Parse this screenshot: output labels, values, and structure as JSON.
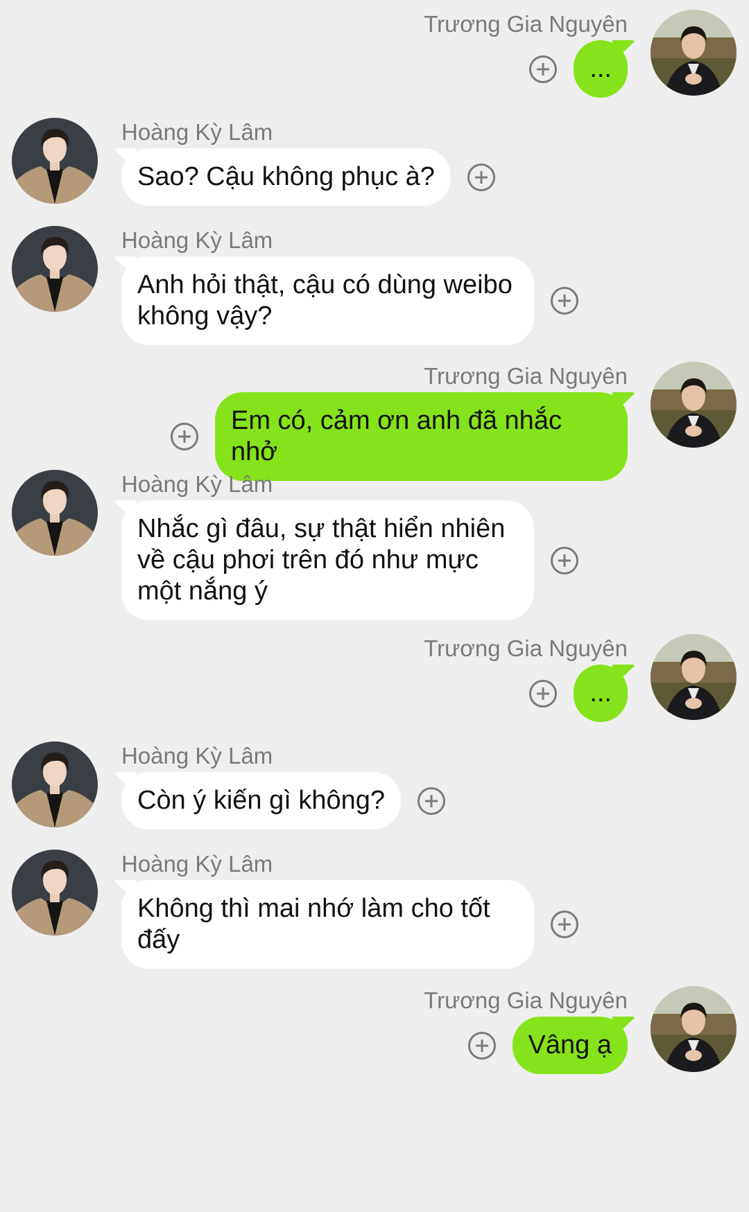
{
  "colors": {
    "background": "#eeeeee",
    "incoming_bubble": "#ffffff",
    "outgoing_bubble": "#85e31b",
    "name_text": "#7a7a7a",
    "icon": "#7b7b7b"
  },
  "participants": {
    "outgoing": {
      "name": "Trương Gia Nguyên",
      "avatar_icon": "avatar-photo-dark-suit"
    },
    "incoming": {
      "name": "Hoàng Kỳ Lâm",
      "avatar_icon": "avatar-photo-beige-coat"
    }
  },
  "messages": [
    {
      "direction": "outgoing",
      "sender": "Trương Gia Nguyên",
      "text": "..."
    },
    {
      "direction": "incoming",
      "sender": "Hoàng Kỳ Lâm",
      "text": "Sao? Cậu không phục à?"
    },
    {
      "direction": "incoming",
      "sender": "Hoàng Kỳ Lâm",
      "text": "Anh hỏi thật, cậu có dùng weibo không vậy?"
    },
    {
      "direction": "outgoing",
      "sender": "Trương Gia Nguyên",
      "text": "Em có, cảm ơn anh đã nhắc nhở"
    },
    {
      "direction": "incoming",
      "sender": "Hoàng Kỳ Lâm",
      "text": "Nhắc gì đâu, sự thật hiển nhiên về cậu phơi trên đó như mực một nắng ý"
    },
    {
      "direction": "outgoing",
      "sender": "Trương Gia Nguyên",
      "text": "..."
    },
    {
      "direction": "incoming",
      "sender": "Hoàng Kỳ Lâm",
      "text": "Còn ý kiến gì không?"
    },
    {
      "direction": "incoming",
      "sender": "Hoàng Kỳ Lâm",
      "text": "Không thì mai nhớ làm cho tốt đấy"
    },
    {
      "direction": "outgoing",
      "sender": "Trương Gia Nguyên",
      "text": "Vâng ạ"
    }
  ]
}
